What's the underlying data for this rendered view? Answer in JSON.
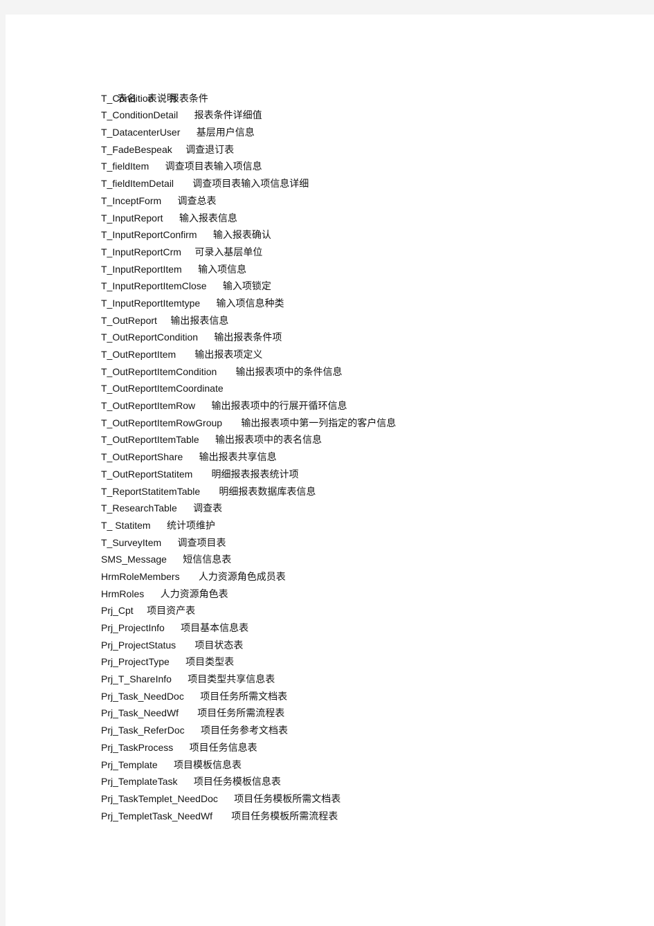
{
  "document": {
    "page_background": "#ffffff",
    "backdrop_color": "#f4f4f4",
    "text_color": "#141414",
    "header": {
      "name_label": "表名",
      "gap": "    ",
      "desc_label": "表说明"
    },
    "rows": [
      {
        "name": "T_Condition",
        "gap": "      ",
        "desc": "报表条件"
      },
      {
        "name": "T_ConditionDetail",
        "gap": "      ",
        "desc": "报表条件详细值"
      },
      {
        "name": "T_DatacenterUser",
        "gap": "      ",
        "desc": "基层用户信息"
      },
      {
        "name": "T_FadeBespeak",
        "gap": "     ",
        "desc": "调查退订表"
      },
      {
        "name": "T_fieldItem",
        "gap": "      ",
        "desc": "调查项目表输入项信息"
      },
      {
        "name": "T_fieldItemDetail",
        "gap": "       ",
        "desc": "调查项目表输入项信息详细"
      },
      {
        "name": "T_InceptForm",
        "gap": "      ",
        "desc": "调查总表"
      },
      {
        "name": "T_InputReport",
        "gap": "      ",
        "desc": "输入报表信息"
      },
      {
        "name": "T_InputReportConfirm",
        "gap": "      ",
        "desc": "输入报表确认"
      },
      {
        "name": "T_InputReportCrm",
        "gap": "     ",
        "desc": "可录入基层单位"
      },
      {
        "name": "T_InputReportItem",
        "gap": "      ",
        "desc": "输入项信息"
      },
      {
        "name": "T_InputReportItemClose",
        "gap": "      ",
        "desc": "输入项锁定"
      },
      {
        "name": "T_InputReportItemtype",
        "gap": "      ",
        "desc": "输入项信息种类"
      },
      {
        "name": "T_OutReport",
        "gap": "     ",
        "desc": "输出报表信息"
      },
      {
        "name": "T_OutReportCondition",
        "gap": "      ",
        "desc": "输出报表条件项"
      },
      {
        "name": "T_OutReportItem",
        "gap": "       ",
        "desc": "输出报表项定义"
      },
      {
        "name": "T_OutReportItemCondition",
        "gap": "       ",
        "desc": "输出报表项中的条件信息"
      },
      {
        "name": "T_OutReportItemCoordinate",
        "gap": "",
        "desc": ""
      },
      {
        "name": "T_OutReportItemRow",
        "gap": "      ",
        "desc": "输出报表项中的行展开循环信息"
      },
      {
        "name": "T_OutReportItemRowGroup",
        "gap": "       ",
        "desc": "输出报表项中第一列指定的客户信息"
      },
      {
        "name": "T_OutReportItemTable",
        "gap": "      ",
        "desc": "输出报表项中的表名信息"
      },
      {
        "name": "T_OutReportShare",
        "gap": "      ",
        "desc": "输出报表共享信息"
      },
      {
        "name": "T_OutReportStatitem",
        "gap": "       ",
        "desc": "明细报表报表统计项"
      },
      {
        "name": "T_ReportStatitemTable",
        "gap": "       ",
        "desc": "明细报表数据库表信息"
      },
      {
        "name": "T_ResearchTable",
        "gap": "      ",
        "desc": "调查表"
      },
      {
        "name": "T_ Statitem",
        "gap": "      ",
        "desc": "统计项维护"
      },
      {
        "name": "T_SurveyItem",
        "gap": "      ",
        "desc": "调查项目表"
      },
      {
        "name": "SMS_Message",
        "gap": "      ",
        "desc": "短信信息表"
      },
      {
        "name": "HrmRoleMembers",
        "gap": "       ",
        "desc": "人力资源角色成员表"
      },
      {
        "name": "HrmRoles",
        "gap": "      ",
        "desc": "人力资源角色表"
      },
      {
        "name": "Prj_Cpt",
        "gap": "     ",
        "desc": "项目资产表"
      },
      {
        "name": "Prj_ProjectInfo",
        "gap": "      ",
        "desc": "项目基本信息表"
      },
      {
        "name": "Prj_ProjectStatus",
        "gap": "       ",
        "desc": "项目状态表"
      },
      {
        "name": "Prj_ProjectType",
        "gap": "      ",
        "desc": "项目类型表"
      },
      {
        "name": "Prj_T_ShareInfo",
        "gap": "      ",
        "desc": "项目类型共享信息表"
      },
      {
        "name": "Prj_Task_NeedDoc",
        "gap": "      ",
        "desc": "项目任务所需文档表"
      },
      {
        "name": "Prj_Task_NeedWf",
        "gap": "       ",
        "desc": "项目任务所需流程表"
      },
      {
        "name": "Prj_Task_ReferDoc",
        "gap": "      ",
        "desc": "项目任务参考文档表"
      },
      {
        "name": "Prj_TaskProcess",
        "gap": "      ",
        "desc": "项目任务信息表"
      },
      {
        "name": "Prj_Template",
        "gap": "      ",
        "desc": "项目模板信息表"
      },
      {
        "name": "Prj_TemplateTask",
        "gap": "      ",
        "desc": "项目任务模板信息表"
      },
      {
        "name": "Prj_TaskTemplet_NeedDoc",
        "gap": "      ",
        "desc": "项目任务模板所需文档表"
      },
      {
        "name": "Prj_TempletTask_NeedWf",
        "gap": "       ",
        "desc": "项目任务模板所需流程表"
      }
    ]
  }
}
